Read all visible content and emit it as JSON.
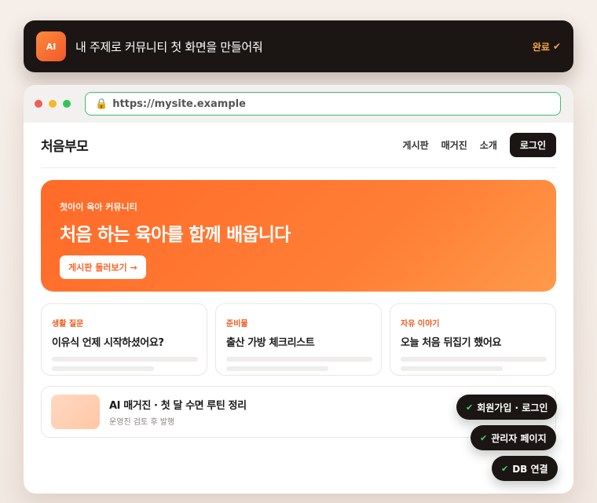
{
  "prompt": {
    "badge": "AI",
    "text": "내 주제로 커뮤니티 첫 화면을 만들어줘",
    "status": "완료",
    "status_icon": "✔"
  },
  "browser": {
    "url": "https://mysite.example"
  },
  "site": {
    "logo": "처음부모",
    "nav": [
      "게시판",
      "매거진",
      "소개"
    ],
    "login": "로그인"
  },
  "hero": {
    "kicker": "첫아이 육아 커뮤니티",
    "title": "처음 하는 육아를 함께 배웁니다",
    "cta": "게시판 둘러보기 →"
  },
  "cards": [
    {
      "tag": "생활 질문",
      "title": "이유식 언제 시작하셨어요?"
    },
    {
      "tag": "준비물",
      "title": "출산 가방 체크리스트"
    },
    {
      "tag": "자유 이야기",
      "title": "오늘 처음 뒤집기 했어요"
    }
  ],
  "magazine": {
    "title": "AI 매거진 · 첫 달 수면 루틴 정리",
    "subtitle": "운영진 검토 후 발행"
  },
  "features": [
    "회원가입 · 로그인",
    "관리자 페이지",
    "DB 연결"
  ],
  "colors": {
    "accent": "#ff6a28",
    "dark": "#1b1614",
    "check_green": "#44d16a",
    "status_orange": "#f5a545"
  }
}
